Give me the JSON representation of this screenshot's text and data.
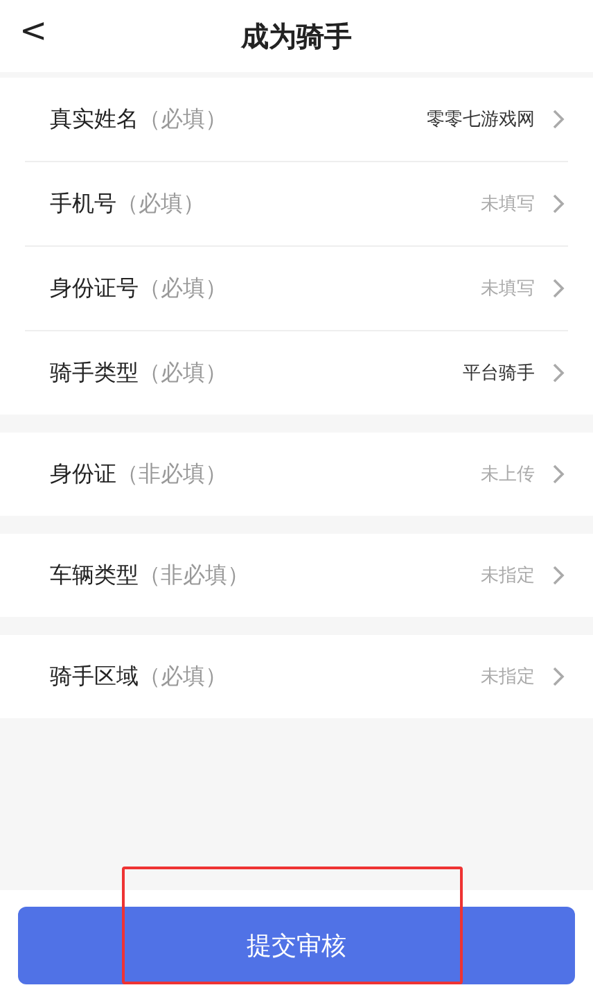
{
  "header": {
    "back": "<",
    "title": "成为骑手"
  },
  "groups": [
    {
      "rows": [
        {
          "label": "真实姓名",
          "hint": "（必填）",
          "value": "零零七游戏网",
          "filled": true
        },
        {
          "label": "手机号",
          "hint": "（必填）",
          "value": "未填写",
          "filled": false
        },
        {
          "label": "身份证号",
          "hint": "（必填）",
          "value": "未填写",
          "filled": false
        },
        {
          "label": "骑手类型",
          "hint": "（必填）",
          "value": "平台骑手",
          "filled": true
        }
      ]
    },
    {
      "rows": [
        {
          "label": "身份证",
          "hint": "（非必填）",
          "value": "未上传",
          "filled": false
        }
      ]
    },
    {
      "rows": [
        {
          "label": "车辆类型",
          "hint": "（非必填）",
          "value": "未指定",
          "filled": false
        }
      ]
    },
    {
      "rows": [
        {
          "label": "骑手区域",
          "hint": "（必填）",
          "value": "未指定",
          "filled": false
        }
      ]
    }
  ],
  "submit_button": {
    "label": "提交审核",
    "highlighted": true
  }
}
